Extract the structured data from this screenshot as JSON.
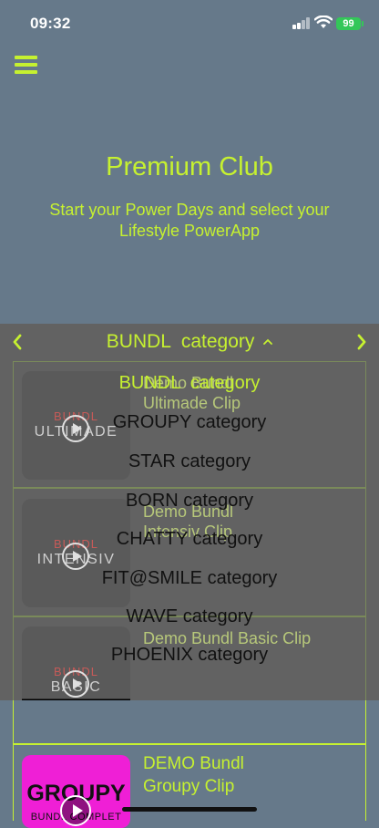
{
  "status": {
    "time": "09:32",
    "battery": "99"
  },
  "header": {
    "menu_icon": "hamburger-icon",
    "title": "Premium Club",
    "subtitle": "Start your Power Days and select your Lifestyle PowerApp"
  },
  "category_bar": {
    "selected": "BUNDL  category",
    "chevron": "^",
    "prev": "‹",
    "next": "›"
  },
  "cards": [
    {
      "brand": "BUNDL",
      "kind": "ULTIMADE",
      "title_line1": "Demo Bundl",
      "title_line2": "Ultimade Clip"
    },
    {
      "brand": "BUNDL",
      "kind": "INTENSIV",
      "title_line1": "Demo Bundl",
      "title_line2": "Intensiv Clip"
    },
    {
      "brand": "BUNDL",
      "kind": "BASIC",
      "title_line1": "Demo Bundl Basic Clip",
      "title_line2": ""
    }
  ],
  "dropdown": {
    "options": [
      "BUNDL  category",
      "GROUPY category",
      "STAR category",
      "BORN category",
      "CHATTY category",
      "FIT@SMILE category",
      "WAVE category",
      "PHOENIX category"
    ]
  },
  "groupy_card": {
    "logo_text": "GROUPY",
    "logo_sub": "BUNDL COMPLET",
    "title_line1": "DEMO Bundl",
    "title_line2": "Groupy Clip"
  },
  "colors": {
    "accent": "#c6f130",
    "background": "#66798a",
    "overlay": "#626262",
    "battery": "#34c759"
  }
}
